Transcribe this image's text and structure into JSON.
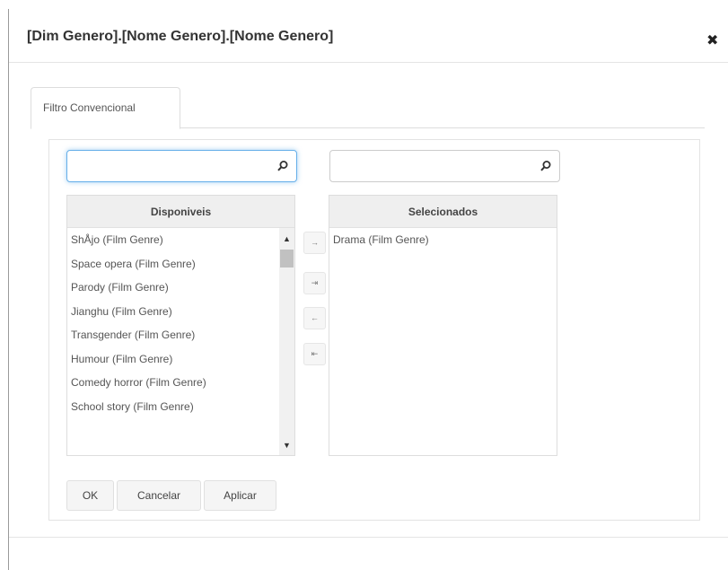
{
  "dialog": {
    "title": "[Dim Genero].[Nome Genero].[Nome Genero]",
    "close_symbol": "✖"
  },
  "tabs": [
    {
      "label": "Filtro Convencional",
      "active": true
    }
  ],
  "available": {
    "search_value": "",
    "header": "Disponiveis",
    "items": [
      "ShÅjo (Film Genre)",
      "Space opera (Film Genre)",
      "Parody (Film Genre)",
      "Jianghu (Film Genre)",
      "Transgender (Film Genre)",
      "Humour (Film Genre)",
      "Comedy horror (Film Genre)",
      "School story (Film Genre)"
    ],
    "scroll_up_symbol": "▲",
    "scroll_down_symbol": "▼"
  },
  "selected": {
    "search_value": "",
    "header": "Selecionados",
    "items": [
      "Drama (Film Genre)"
    ]
  },
  "move_buttons": {
    "add": "→",
    "add_all": "⇥",
    "remove": "←",
    "remove_all": "⇤"
  },
  "buttons": {
    "ok": "OK",
    "cancel": "Cancelar",
    "apply": "Aplicar"
  },
  "icons": {
    "search": "search-icon",
    "close": "close-icon"
  },
  "colors": {
    "focus_border": "#66afe9",
    "header_bg": "#efefef"
  }
}
